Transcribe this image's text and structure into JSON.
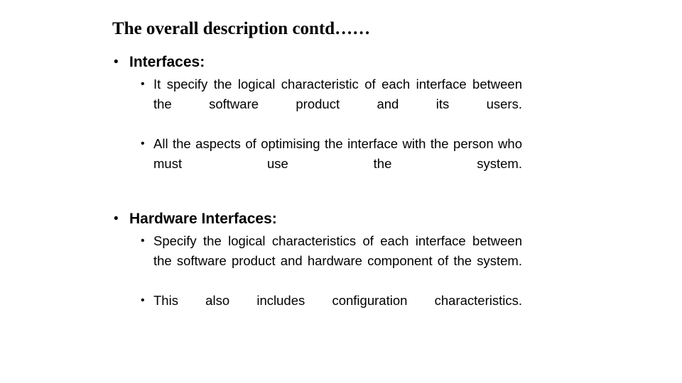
{
  "slide": {
    "title": "The overall description contd……",
    "background_color": "#ffffff",
    "text_color": "#000000",
    "bullet_glyph": "•",
    "sections": [
      {
        "heading": "Interfaces:",
        "items": [
          "It specify the logical characteristic of each interface between the software product and its users.",
          "All the aspects of optimising the interface with the person who must use the system."
        ]
      },
      {
        "heading": "Hardware Interfaces:",
        "items": [
          "Specify the logical characteristics of each interface between the software product and hardware component of the system.",
          "This also includes configuration characteristics."
        ]
      }
    ]
  }
}
